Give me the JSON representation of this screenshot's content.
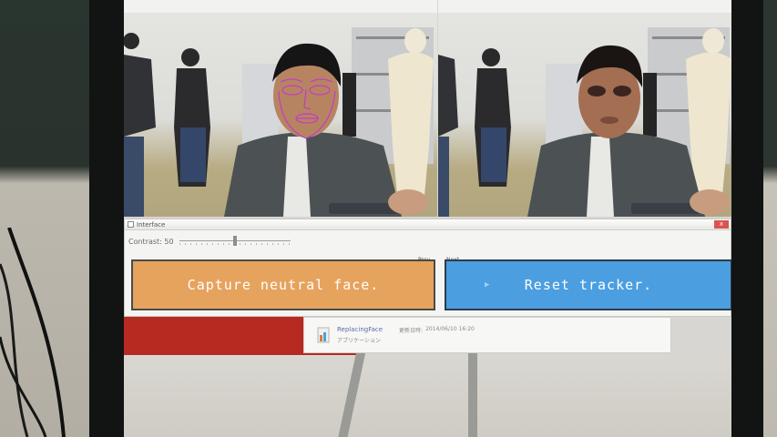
{
  "interface_window": {
    "title": "Interface",
    "close_symbol": "x",
    "contrast_label": "Contrast: 50",
    "contrast_value": 50,
    "prev_label": "Prev",
    "next_label": "Next",
    "prev_symbol": "<",
    "next_symbol": ">",
    "capture_button_label": "Capture neutral face.",
    "reset_button_label": "Reset tracker.",
    "play_glyph": "▶"
  },
  "file_notification": {
    "file_name": "ReplacingFace",
    "file_type": "アプリケーション",
    "modified_label": "更新日時:",
    "modified_date": "2014/06/10 16:20"
  },
  "colors": {
    "capture_button": "#e6a35d",
    "reset_button": "#4b9ee0",
    "tracking_mesh": "#c13cc6"
  },
  "icons": [
    "app-window-icon",
    "close-icon",
    "chevron-left-icon",
    "chevron-right-icon",
    "play-icon",
    "application-file-icon"
  ]
}
